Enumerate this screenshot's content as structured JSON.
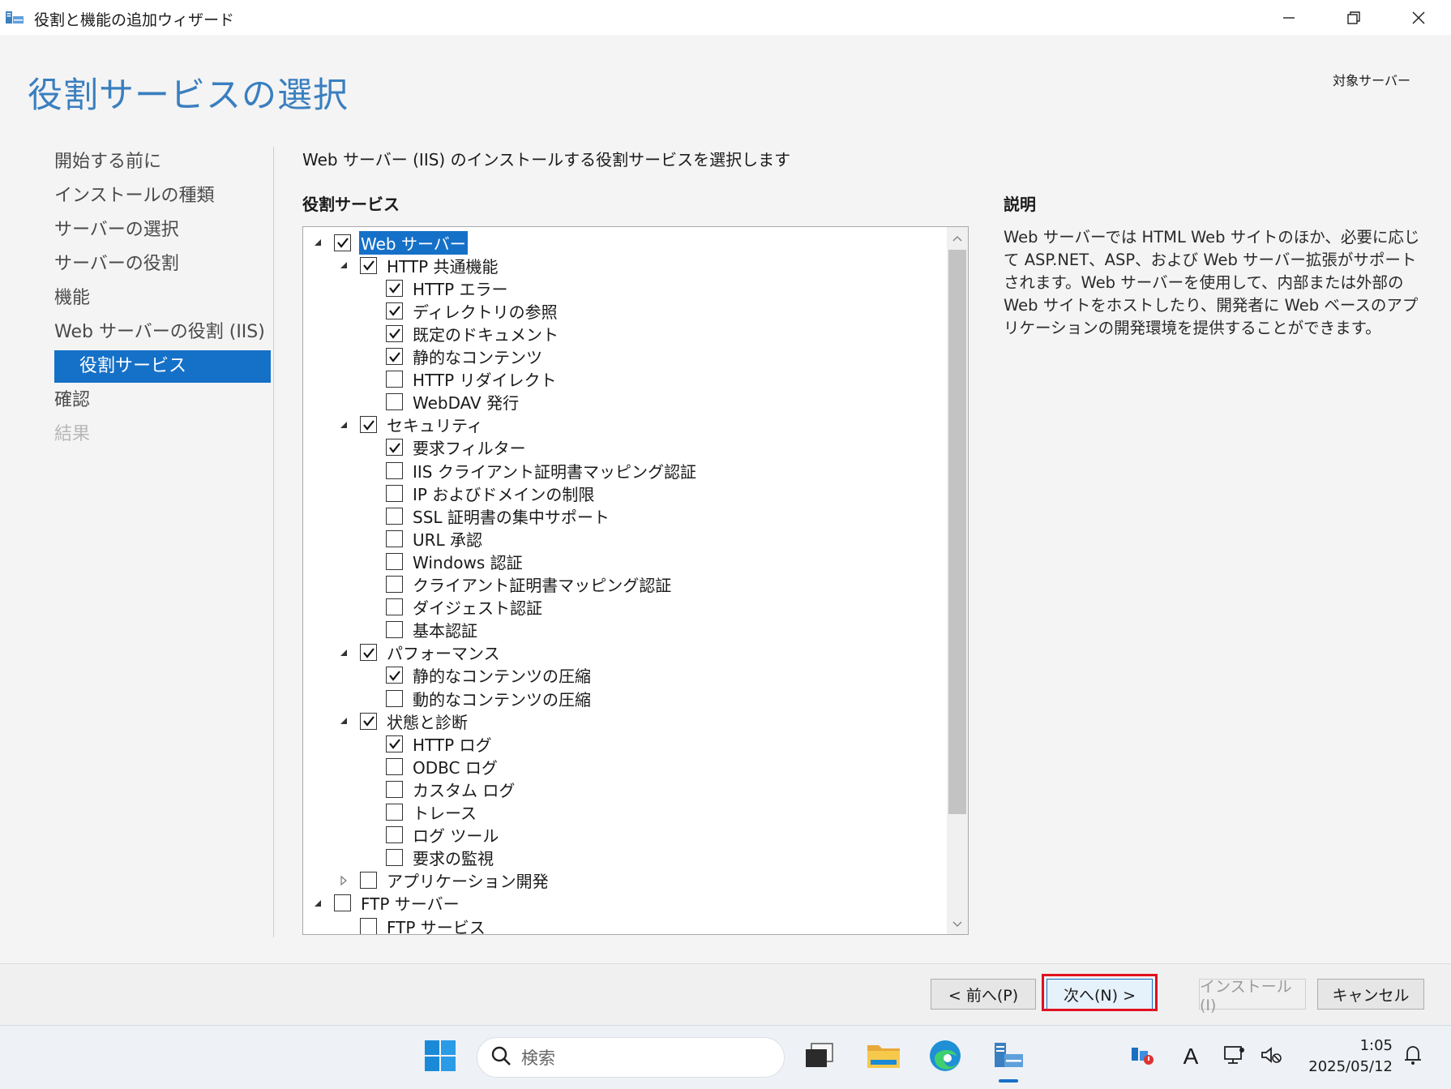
{
  "window": {
    "title": "役割と機能の追加ウィザード",
    "controls": [
      "minimize-icon",
      "restore-icon",
      "close-icon"
    ]
  },
  "page": {
    "title": "役割サービスの選択",
    "target_server_label": "対象サーバー"
  },
  "steps": [
    {
      "label": "開始する前に",
      "state": "normal"
    },
    {
      "label": "インストールの種類",
      "state": "normal"
    },
    {
      "label": "サーバーの選択",
      "state": "normal"
    },
    {
      "label": "サーバーの役割",
      "state": "normal"
    },
    {
      "label": "機能",
      "state": "normal"
    },
    {
      "label": "Web サーバーの役割 (IIS)",
      "state": "normal"
    },
    {
      "label": "役割サービス",
      "state": "active"
    },
    {
      "label": "確認",
      "state": "normal"
    },
    {
      "label": "結果",
      "state": "disabled"
    }
  ],
  "main": {
    "instruction": "Web サーバー (IIS) のインストールする役割サービスを選択します",
    "section_label": "役割サービス",
    "description_label": "説明",
    "description_text": "Web サーバーでは HTML Web サイトのほか、必要に応じて ASP.NET、ASP、および Web サーバー拡張がサポートされます。Web サーバーを使用して、内部または外部の Web サイトをホストしたり、開発者に Web ベースのアプリケーションの開発環境を提供することができます。"
  },
  "tree": [
    {
      "label": "Web サーバー",
      "level": 0,
      "checked": true,
      "expander": "expanded",
      "selected": true
    },
    {
      "label": "HTTP 共通機能",
      "level": 1,
      "checked": true,
      "expander": "expanded"
    },
    {
      "label": "HTTP エラー",
      "level": 2,
      "checked": true
    },
    {
      "label": "ディレクトリの参照",
      "level": 2,
      "checked": true
    },
    {
      "label": "既定のドキュメント",
      "level": 2,
      "checked": true
    },
    {
      "label": "静的なコンテンツ",
      "level": 2,
      "checked": true
    },
    {
      "label": "HTTP リダイレクト",
      "level": 2,
      "checked": false
    },
    {
      "label": "WebDAV 発行",
      "level": 2,
      "checked": false
    },
    {
      "label": "セキュリティ",
      "level": 1,
      "checked": true,
      "expander": "expanded"
    },
    {
      "label": "要求フィルター",
      "level": 2,
      "checked": true
    },
    {
      "label": "IIS クライアント証明書マッピング認証",
      "level": 2,
      "checked": false
    },
    {
      "label": "IP およびドメインの制限",
      "level": 2,
      "checked": false
    },
    {
      "label": "SSL 証明書の集中サポート",
      "level": 2,
      "checked": false
    },
    {
      "label": "URL 承認",
      "level": 2,
      "checked": false
    },
    {
      "label": "Windows 認証",
      "level": 2,
      "checked": false
    },
    {
      "label": "クライアント証明書マッピング認証",
      "level": 2,
      "checked": false
    },
    {
      "label": "ダイジェスト認証",
      "level": 2,
      "checked": false
    },
    {
      "label": "基本認証",
      "level": 2,
      "checked": false
    },
    {
      "label": "パフォーマンス",
      "level": 1,
      "checked": true,
      "expander": "expanded"
    },
    {
      "label": "静的なコンテンツの圧縮",
      "level": 2,
      "checked": true
    },
    {
      "label": "動的なコンテンツの圧縮",
      "level": 2,
      "checked": false
    },
    {
      "label": "状態と診断",
      "level": 1,
      "checked": true,
      "expander": "expanded"
    },
    {
      "label": "HTTP ログ",
      "level": 2,
      "checked": true
    },
    {
      "label": "ODBC ログ",
      "level": 2,
      "checked": false
    },
    {
      "label": "カスタム ログ",
      "level": 2,
      "checked": false
    },
    {
      "label": "トレース",
      "level": 2,
      "checked": false
    },
    {
      "label": "ログ ツール",
      "level": 2,
      "checked": false
    },
    {
      "label": "要求の監視",
      "level": 2,
      "checked": false
    },
    {
      "label": "アプリケーション開発",
      "level": 1,
      "checked": false,
      "expander": "collapsed"
    },
    {
      "label": "FTP サーバー",
      "level": 0,
      "checked": false,
      "expander": "expanded"
    },
    {
      "label": "FTP サービス",
      "level": 1,
      "checked": false
    }
  ],
  "buttons": {
    "previous": "< 前へ(P)",
    "next": "次へ(N) >",
    "install": "インストール(I)",
    "cancel": "キャンセル"
  },
  "taskbar": {
    "search_placeholder": "検索",
    "ime_indicator": "A",
    "time": "1:05",
    "date": "2025/05/12"
  },
  "colors": {
    "accent": "#1570c8",
    "title_blue": "#3a7fbf",
    "highlight_red": "#e0101e"
  }
}
